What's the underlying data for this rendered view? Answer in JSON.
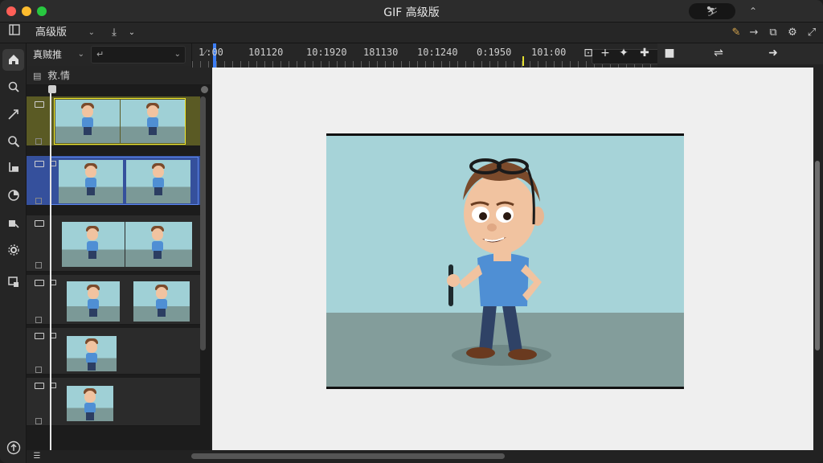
{
  "window": {
    "title": "GIF 高级版",
    "pill_label": "⛷",
    "collapse_label": "⌃"
  },
  "toolbar": {
    "mode": "高级版",
    "mode_chevron": "⌄",
    "export_icon": "⤓",
    "export_chevron": "⌄",
    "right_icons": [
      "✎",
      "→",
      "⧉",
      "⚙",
      "⤢"
    ]
  },
  "rail": {
    "items": [
      "home",
      "zoom-select",
      "arrow",
      "search",
      "crop",
      "effects",
      "transform",
      "settings",
      "export-frame",
      "upload"
    ]
  },
  "strip": {
    "select1": "真贼推",
    "select1_chevron": "⌄",
    "select2": "↵",
    "select2_chevron": "⌄",
    "sub_label": "救.情",
    "sub_icon": "▤"
  },
  "ruler": {
    "labels": [
      "1⁄:00",
      "101120",
      "10:1920",
      "181130",
      "10:1240",
      "0:1950",
      "101:00"
    ],
    "controls": [
      "⊡",
      "+",
      "✦",
      "✚"
    ],
    "extra": [
      "■",
      "⇌",
      "➜"
    ]
  },
  "colors": {
    "selected_yellow": "#f0e830",
    "selected_blue": "#5c87f0",
    "playhead": "#3d7ef5"
  }
}
